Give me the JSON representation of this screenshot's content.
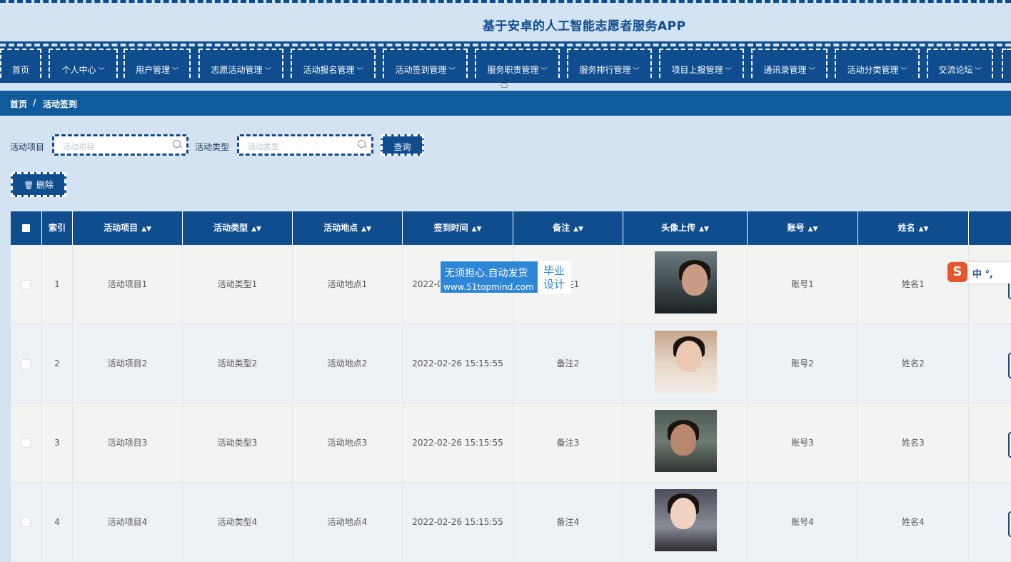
{
  "app_title": "基于安卓的人工智能志愿者服务APP",
  "nav": [
    {
      "label": "首页",
      "has_menu": false
    },
    {
      "label": "个人中心",
      "has_menu": true
    },
    {
      "label": "用户管理",
      "has_menu": true
    },
    {
      "label": "志愿活动管理",
      "has_menu": true
    },
    {
      "label": "活动报名管理",
      "has_menu": true
    },
    {
      "label": "活动签到管理",
      "has_menu": true
    },
    {
      "label": "服务职责管理",
      "has_menu": true
    },
    {
      "label": "服务排行管理",
      "has_menu": true
    },
    {
      "label": "项目上报管理",
      "has_menu": true
    },
    {
      "label": "通讯录管理",
      "has_menu": true
    },
    {
      "label": "活动分类管理",
      "has_menu": true
    },
    {
      "label": "交流论坛",
      "has_menu": true
    }
  ],
  "breadcrumb": {
    "home": "首页",
    "separator": "/",
    "current": "活动签到"
  },
  "search": {
    "project_label": "活动项目",
    "project_placeholder": "活动项目",
    "type_label": "活动类型",
    "type_placeholder": "活动类型",
    "query_button": "查询"
  },
  "actions": {
    "delete_button": "删除"
  },
  "table": {
    "columns": [
      "索引",
      "活动项目",
      "活动类型",
      "活动地点",
      "签到时间",
      "备注",
      "头像上传",
      "账号",
      "姓名"
    ],
    "rows": [
      {
        "index": "1",
        "project": "活动项目1",
        "type": "活动类型1",
        "location": "活动地点1",
        "time": "2022-02-26 15:15:55",
        "note": "备注1",
        "account": "账号1",
        "name": "姓名1"
      },
      {
        "index": "2",
        "project": "活动项目2",
        "type": "活动类型2",
        "location": "活动地点2",
        "time": "2022-02-26 15:15:55",
        "note": "备注2",
        "account": "账号2",
        "name": "姓名2"
      },
      {
        "index": "3",
        "project": "活动项目3",
        "type": "活动类型3",
        "location": "活动地点3",
        "time": "2022-02-26 15:15:55",
        "note": "备注3",
        "account": "账号3",
        "name": "姓名3"
      },
      {
        "index": "4",
        "project": "活动项目4",
        "type": "活动类型4",
        "location": "活动地点4",
        "time": "2022-02-26 15:15:55",
        "note": "备注4",
        "account": "账号4",
        "name": "姓名4"
      }
    ]
  },
  "watermark": {
    "line1": "无须担心.自动发货",
    "line2": "www.51topmind.com",
    "badge_line1": "毕业",
    "badge_line2": "设计"
  },
  "ime": {
    "logo": "S",
    "text": "中 °,"
  },
  "colors": {
    "primary": "#0f4d8f",
    "page_bg": "#d3e3f1",
    "crumb_bg": "#0f5b9b"
  },
  "icons": {
    "delete": "trash-icon",
    "search": "search-icon",
    "sort": "sort-icon",
    "dropdown": "chevron-down-icon"
  }
}
